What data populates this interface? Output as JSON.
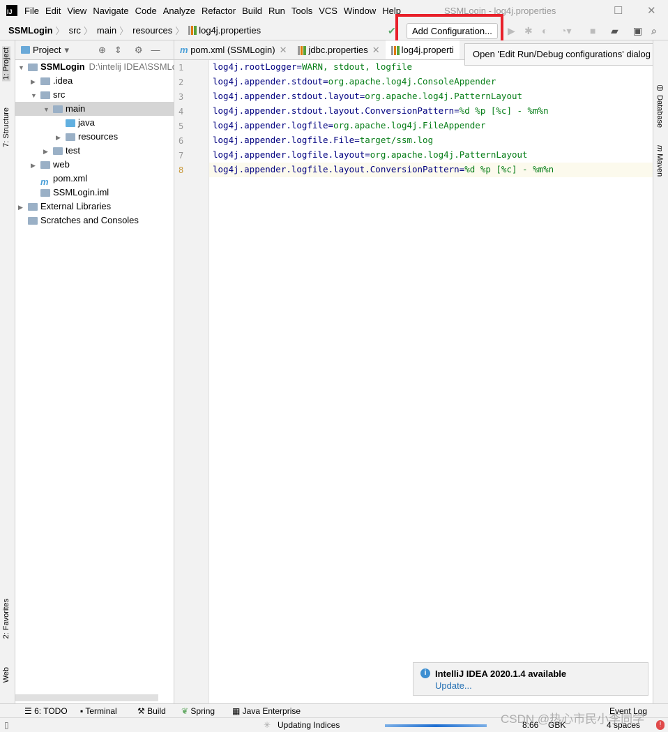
{
  "titlebar": {
    "menu": [
      "File",
      "Edit",
      "View",
      "Navigate",
      "Code",
      "Analyze",
      "Refactor",
      "Build",
      "Run",
      "Tools",
      "VCS",
      "Window",
      "Help"
    ],
    "window_title": "SSMLogin - log4j.properties"
  },
  "navbar": {
    "breadcrumbs": [
      "SSMLogin",
      "src",
      "main",
      "resources",
      "log4j.properties"
    ],
    "add_configuration": "Add Configuration..."
  },
  "tooltip": "Open 'Edit Run/Debug configurations' dialog",
  "left_stripe": {
    "project": "1: Project",
    "structure": "7: Structure",
    "favorites": "2: Favorites",
    "web": "Web"
  },
  "right_stripe": {
    "database": "Database",
    "maven": "Maven"
  },
  "project": {
    "title": "Project",
    "tree": [
      {
        "label": "SSMLogin",
        "extra": "D:\\intelij IDEA\\SSMLo",
        "level": 0,
        "arrow": "down",
        "bold": true
      },
      {
        "label": ".idea",
        "level": 1,
        "arrow": "right"
      },
      {
        "label": "src",
        "level": 1,
        "arrow": "down"
      },
      {
        "label": "main",
        "level": 2,
        "arrow": "down",
        "selected": true
      },
      {
        "label": "java",
        "level": 3,
        "arrow": ""
      },
      {
        "label": "resources",
        "level": 3,
        "arrow": "right"
      },
      {
        "label": "test",
        "level": 2,
        "arrow": "right"
      },
      {
        "label": "web",
        "level": 1,
        "arrow": "right"
      },
      {
        "label": "pom.xml",
        "level": 1,
        "arrow": ""
      },
      {
        "label": "SSMLogin.iml",
        "level": 1,
        "arrow": ""
      },
      {
        "label": "External Libraries",
        "level": 0,
        "arrow": "right"
      },
      {
        "label": "Scratches and Consoles",
        "level": 0,
        "arrow": ""
      }
    ]
  },
  "tabs": [
    {
      "label": "pom.xml (SSMLogin)"
    },
    {
      "label": "jdbc.properties"
    },
    {
      "label": "log4j.properti",
      "active": true
    }
  ],
  "code": [
    {
      "k": "log4j.rootLogger",
      "v": "WARN, stdout, logfile"
    },
    {
      "k": "log4j.appender.stdout",
      "v": "org.apache.log4j.ConsoleAppender"
    },
    {
      "k": "log4j.appender.stdout.layout",
      "v": "org.apache.log4j.PatternLayout"
    },
    {
      "k": "log4j.appender.stdout.layout.ConversionPattern",
      "v": "%d %p [%c] - %m%n"
    },
    {
      "k": "log4j.appender.logfile",
      "v": "org.apache.log4j.FileAppender"
    },
    {
      "k": "log4j.appender.logfile.File",
      "v": "target/ssm.log"
    },
    {
      "k": "log4j.appender.logfile.layout",
      "v": "org.apache.log4j.PatternLayout"
    },
    {
      "k": "log4j.appender.logfile.layout.ConversionPattern",
      "v": "%d %p [%c] - %m%n"
    }
  ],
  "notification": {
    "title": "IntelliJ IDEA 2020.1.4 available",
    "link": "Update..."
  },
  "toolwindows": [
    "6: TODO",
    "Terminal",
    "Build",
    "Spring",
    "Java Enterprise"
  ],
  "event_log": "Event Log",
  "status": {
    "task": "Updating Indices",
    "position": "8:66",
    "encoding": "GBK",
    "indent": "4 spaces",
    "progress": 0.6
  },
  "watermark": "CSDN @热心市民小李同学",
  "colors": {
    "key": "#000080",
    "value": "#067d17",
    "highlight": "#e8202a"
  }
}
